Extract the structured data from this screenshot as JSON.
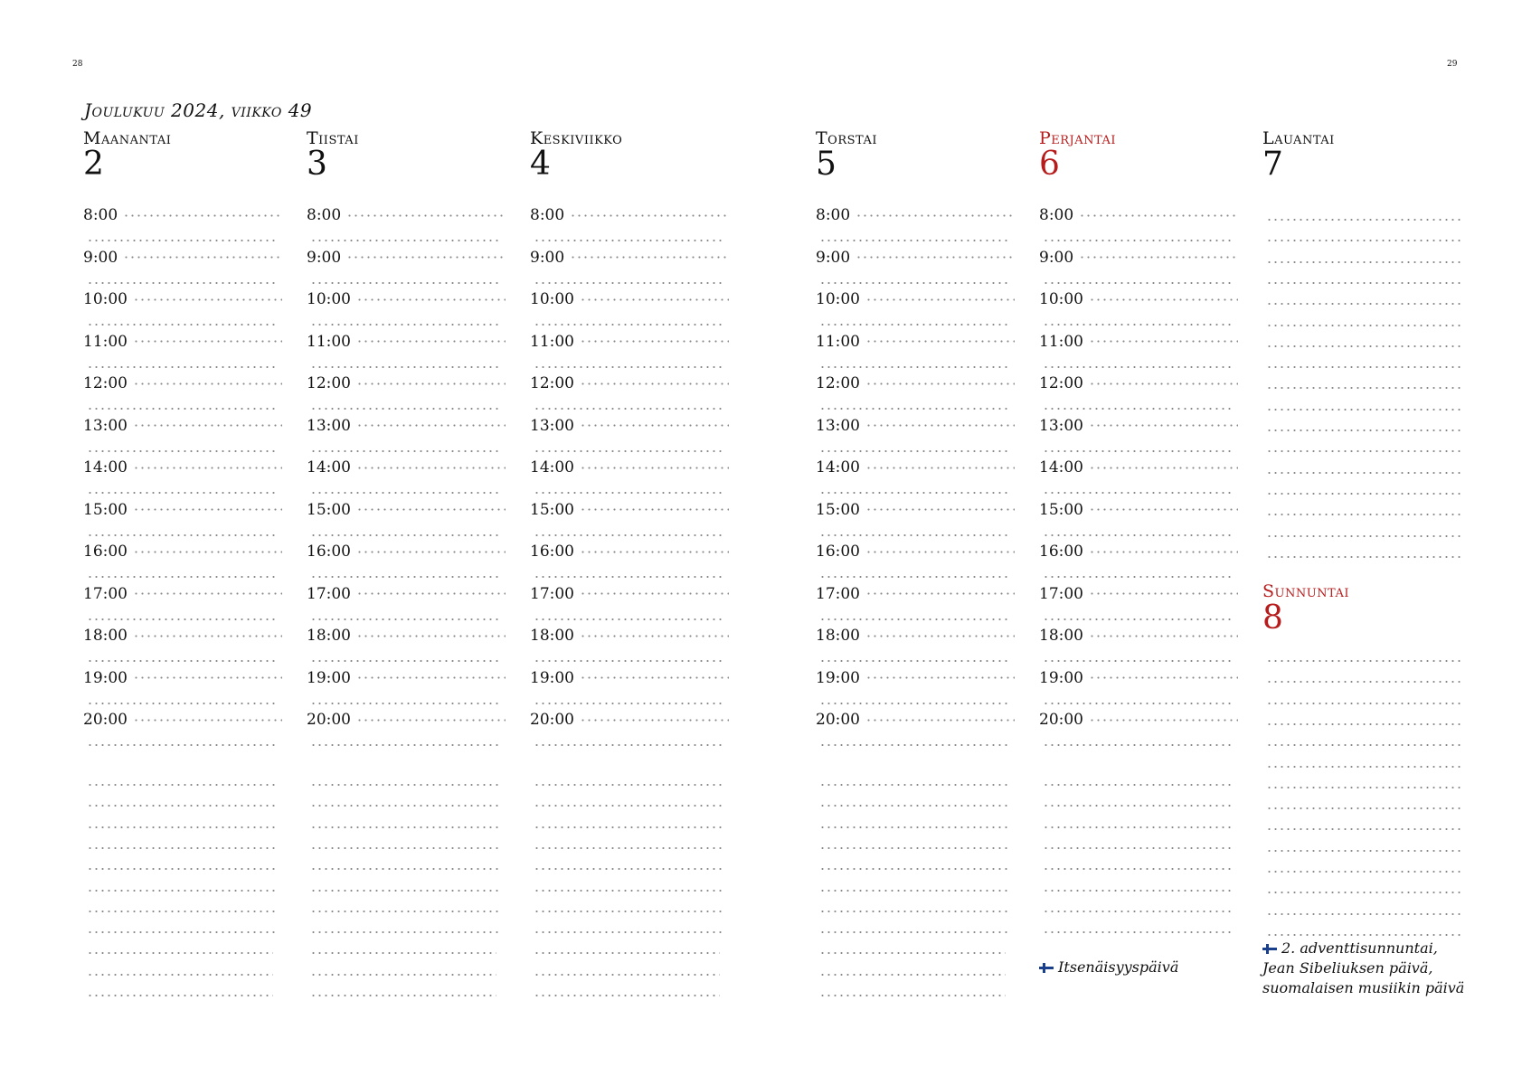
{
  "pages": {
    "left": "28",
    "right": "29"
  },
  "week_title": "Joulukuu 2024, viikko 49",
  "days": [
    {
      "name": "Maanantai",
      "date": "2"
    },
    {
      "name": "Tiistai",
      "date": "3"
    },
    {
      "name": "Keskiviikko",
      "date": "4"
    },
    {
      "name": "Torstai",
      "date": "5"
    },
    {
      "name": "Perjantai",
      "date": "6"
    },
    {
      "name": "Lauantai",
      "date": "7"
    },
    {
      "name": "Sunnuntai",
      "date": "8"
    }
  ],
  "hours": [
    "8:00",
    "9:00",
    "10:00",
    "11:00",
    "12:00",
    "13:00",
    "14:00",
    "15:00",
    "16:00",
    "17:00",
    "18:00",
    "19:00",
    "20:00"
  ],
  "notes": {
    "friday": "Itsenäisyyspäivä",
    "sunday": [
      "2. adventtisunnuntai,",
      "Jean Sibeliuksen päivä,",
      "suomalaisen musiikin päivä"
    ]
  },
  "colors": {
    "holiday_red": "#b71c1c",
    "flag_blue": "#1a3f8c"
  }
}
